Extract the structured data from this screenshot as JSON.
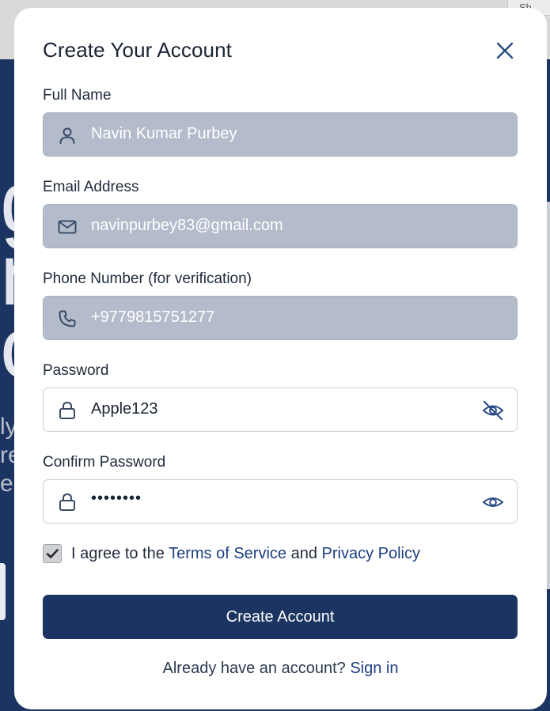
{
  "background": {
    "top_button_label": "Sh",
    "hero_letters": [
      "g",
      "n",
      "o"
    ],
    "hero_lines": [
      "ly",
      "re",
      "e r"
    ]
  },
  "modal": {
    "title": "Create Your Account",
    "close_icon": "close-icon"
  },
  "form": {
    "full_name": {
      "label": "Full Name",
      "value": "Navin Kumar Purbey",
      "icon": "user-icon",
      "disabled": true
    },
    "email": {
      "label": "Email Address",
      "value": "navinpurbey83@gmail.com",
      "icon": "mail-icon",
      "disabled": true
    },
    "phone": {
      "label": "Phone Number (for verification)",
      "value": "+9779815751277",
      "icon": "phone-icon",
      "disabled": true
    },
    "password": {
      "label": "Password",
      "value": "Apple123",
      "icon": "lock-icon",
      "visibility_icon": "eye-off-icon"
    },
    "confirm_password": {
      "label": "Confirm Password",
      "value": "••••••••",
      "icon": "lock-icon",
      "visibility_icon": "eye-icon"
    }
  },
  "agreement": {
    "checked": true,
    "prefix": "I agree to the",
    "terms_link": "Terms of Service",
    "conjunction": "and",
    "privacy_link": "Privacy Policy"
  },
  "submit": {
    "label": "Create Account"
  },
  "signin": {
    "prompt": "Already have an account?",
    "link": "Sign in"
  },
  "colors": {
    "primary": "#1c3461",
    "link": "#1d3f80",
    "disabled_field": "#b4bccb",
    "modal_bg": "#ffffff"
  }
}
